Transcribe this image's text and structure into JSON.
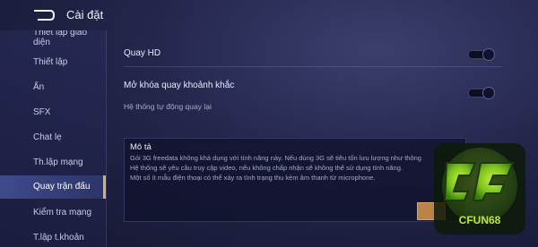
{
  "header": {
    "title": "Cài đặt"
  },
  "sidebar": {
    "items": [
      {
        "label": "Thiết lập giao"
      },
      {
        "label": "diện"
      },
      {
        "label": "Thiết lập"
      },
      {
        "label": "Ẩn"
      },
      {
        "label": "SFX"
      },
      {
        "label": "Chat lẹ"
      },
      {
        "label": "Th.lập mạng"
      },
      {
        "label": "Quay trận đấu"
      },
      {
        "label": "Kiểm tra mạng"
      },
      {
        "label": "T.lập t.khoản"
      }
    ],
    "active_index": 7
  },
  "settings": {
    "hd": {
      "label": "Quay HD",
      "on": false
    },
    "moment": {
      "label": "Mở khóa quay khoảnh khắc",
      "on": false
    },
    "auto_hint": "Hệ thống tự động quay lại"
  },
  "description": {
    "title": "Mô tả",
    "lines": [
      "Gói 3G freedata không khả dụng với tính năng này. Nếu dùng 3G sẽ tiêu tốn lưu lượng như thông",
      "Hệ thống sẽ yêu cầu truy cập video, nếu không chấp nhận sẽ không thể sử dụng tính năng.",
      "Một số ít mẫu điện thoại có thể xảy ra tình trạng thu kèm âm thanh từ microphone."
    ]
  },
  "watermark": {
    "text": "CFUN68"
  },
  "colors": {
    "accent": "#d9b06a",
    "button": "#b98448"
  }
}
